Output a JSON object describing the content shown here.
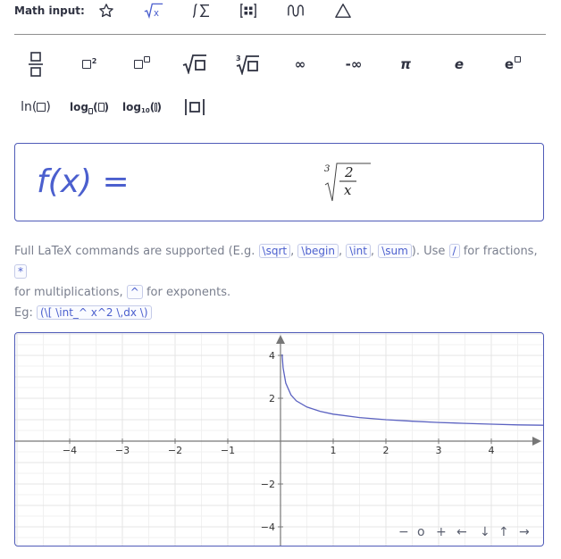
{
  "toolbar": {
    "label": "Math input:",
    "tabs": [
      {
        "icon": "star-icon",
        "active": false
      },
      {
        "icon": "sqrt-x-icon",
        "active": true
      },
      {
        "icon": "integral-sum-icon",
        "active": false
      },
      {
        "icon": "matrix-icon",
        "active": false
      },
      {
        "icon": "wave-icon",
        "active": false
      },
      {
        "icon": "triangle-icon",
        "active": false
      }
    ]
  },
  "keypad": {
    "row1": [
      "fraction",
      "square",
      "power",
      "sqrt",
      "cube-root",
      "∞",
      "-∞",
      "π",
      "e",
      "e-power"
    ],
    "row2": [
      "ln",
      "log-base",
      "log10",
      "abs"
    ],
    "labels": {
      "inf": "∞",
      "neg_inf": "-∞",
      "pi": "π",
      "e": "e",
      "ln": "ln",
      "log": "log",
      "log10": "log",
      "log10_sub": "10",
      "root_index": "3",
      "sup2": "2"
    }
  },
  "math": {
    "prefix": "f(x) =",
    "root_index": "3",
    "numerator": "2",
    "denominator": "x"
  },
  "help": {
    "line1_a": "Full LaTeX commands are supported (E.g.",
    "cmds": [
      "\\sqrt",
      "\\begin",
      "\\int",
      "\\sum"
    ],
    "line1_b": "). Use",
    "slash": "/",
    "line1_c": "for fractions,",
    "star": "*",
    "line2_a": "for multiplications,",
    "caret": "^",
    "line2_b": "for exponents.",
    "eg_label": "Eg:",
    "eg_code": "(\\[ \\int_^ x^2 \\,dx \\)"
  },
  "chart_data": {
    "type": "line",
    "function": "cbrt(2/x)",
    "series": [
      {
        "x": [
          0.03,
          0.05,
          0.1,
          0.2,
          0.3,
          0.5,
          0.75,
          1,
          1.5,
          2,
          2.5,
          3,
          3.5,
          4,
          4.5,
          5
        ],
        "y": [
          4.05,
          3.42,
          2.71,
          2.15,
          1.88,
          1.59,
          1.39,
          1.26,
          1.1,
          1.0,
          0.93,
          0.87,
          0.83,
          0.79,
          0.76,
          0.74
        ]
      }
    ],
    "xlim": [
      -5,
      5
    ],
    "ylim": [
      -5,
      5
    ],
    "x_ticks": [
      "−4",
      "−3",
      "−2",
      "−1",
      "1",
      "2",
      "3",
      "4"
    ],
    "y_ticks": [
      "4",
      "2",
      "−2",
      "−4"
    ],
    "grid": true,
    "color": "#5b62c1"
  },
  "graph_controls": [
    "−",
    "o",
    "+",
    "←",
    "↓",
    "↑",
    "→"
  ],
  "colors": {
    "accent": "#4b5fce",
    "border": "#4f5bb8"
  }
}
